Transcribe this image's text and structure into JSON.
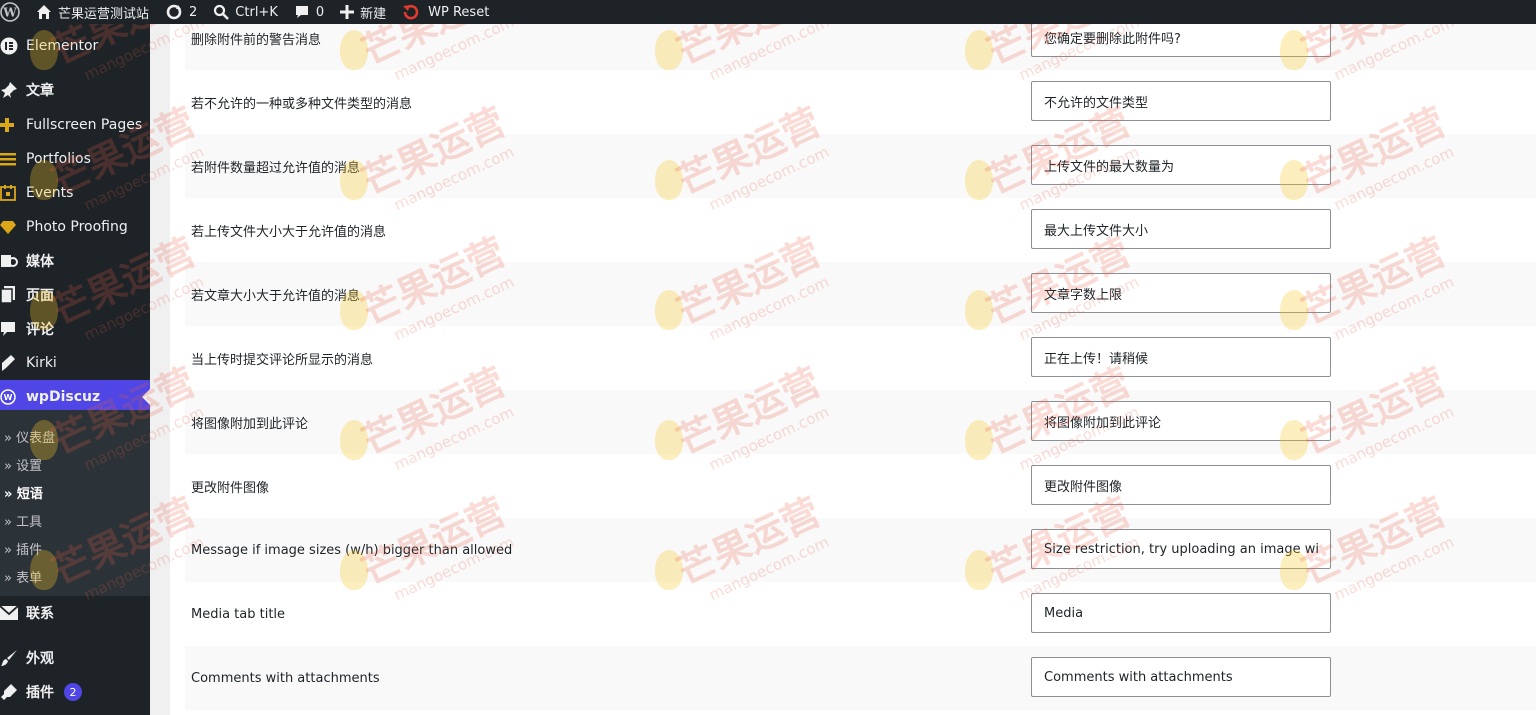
{
  "admin_bar": {
    "site_name": "芒果运营测试站",
    "updates_count": "2",
    "search_shortcut": "Ctrl+K",
    "comments_count": "0",
    "new_label": "新建",
    "wp_reset_label": "WP Reset"
  },
  "sidebar": {
    "items": [
      {
        "label": "Elementor",
        "icon": "elementor-icon"
      },
      {
        "label": "文章",
        "icon": "pin-icon"
      },
      {
        "label": "Fullscreen Pages",
        "icon": "plus-icon"
      },
      {
        "label": "Portfolios",
        "icon": "list-icon"
      },
      {
        "label": "Events",
        "icon": "calendar-icon"
      },
      {
        "label": "Photo Proofing",
        "icon": "diamond-icon"
      },
      {
        "label": "媒体",
        "icon": "media-icon"
      },
      {
        "label": "页面",
        "icon": "pages-icon"
      },
      {
        "label": "评论",
        "icon": "comment-icon"
      },
      {
        "label": "Kirki",
        "icon": "kirki-icon"
      },
      {
        "label": "wpDiscuz",
        "icon": "wpdiscuz-icon"
      },
      {
        "label": "联系",
        "icon": "mail-icon"
      },
      {
        "label": "外观",
        "icon": "brush-icon"
      },
      {
        "label": "插件",
        "icon": "plugin-icon",
        "badge": "2"
      }
    ],
    "submenu": [
      {
        "label": "» 仪表盘"
      },
      {
        "label": "» 设置"
      },
      {
        "label": "» 短语"
      },
      {
        "label": "» 工具"
      },
      {
        "label": "» 插件"
      },
      {
        "label": "» 表单"
      }
    ]
  },
  "rows": [
    {
      "label": "删除附件前的警告消息",
      "value": "您确定要删除此附件吗?"
    },
    {
      "label": "若不允许的一种或多种文件类型的消息",
      "value": "不允许的文件类型"
    },
    {
      "label": "若附件数量超过允许值的消息",
      "value": "上传文件的最大数量为"
    },
    {
      "label": "若上传文件大小大于允许值的消息",
      "value": "最大上传文件大小"
    },
    {
      "label": "若文章大小大于允许值的消息",
      "value": "文章字数上限"
    },
    {
      "label": "当上传时提交评论所显示的消息",
      "value": "正在上传！请稍候"
    },
    {
      "label": "将图像附加到此评论",
      "value": "将图像附加到此评论"
    },
    {
      "label": "更改附件图像",
      "value": "更改附件图像"
    },
    {
      "label": "Message if image sizes (w/h) bigger than allowed",
      "value": "Size restriction, try uploading an image with"
    },
    {
      "label": "Media tab title",
      "value": "Media"
    },
    {
      "label": "Comments with attachments",
      "value": "Comments with attachments"
    }
  ],
  "watermark": {
    "text": "芒果运营",
    "sub": "mangoecom.com"
  }
}
